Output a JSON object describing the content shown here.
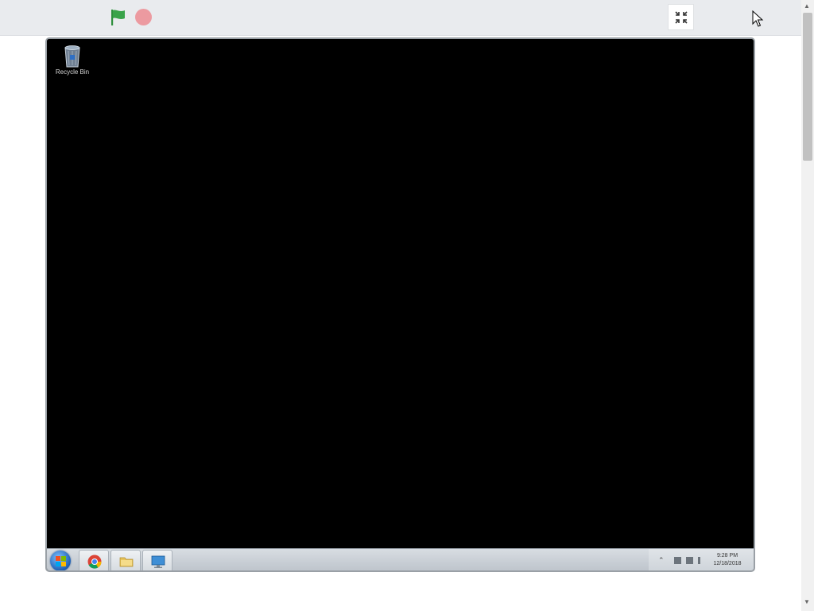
{
  "toolbar": {
    "icons": {
      "run": "green-flag-icon",
      "stop": "stop-icon",
      "exit_fullscreen": "collapse-icon",
      "cursor": "mouse-pointer"
    }
  },
  "desktop": {
    "icons": [
      {
        "label": "Recycle Bin",
        "icon": "recycle-bin-icon"
      }
    ]
  },
  "taskbar": {
    "start_icon": "windows-start-orb",
    "pinned": [
      {
        "name": "chrome",
        "icon": "chrome-icon"
      },
      {
        "name": "explorer",
        "icon": "folder-icon"
      },
      {
        "name": "remote",
        "icon": "monitor-icon"
      }
    ],
    "tray": {
      "time": "9:28 PM",
      "date": "12/18/2018"
    }
  },
  "colors": {
    "flag": "#3aa34a",
    "stop": "#ec9aa0",
    "desktop": "#000000",
    "toolbar_bg": "#e9ebee"
  }
}
